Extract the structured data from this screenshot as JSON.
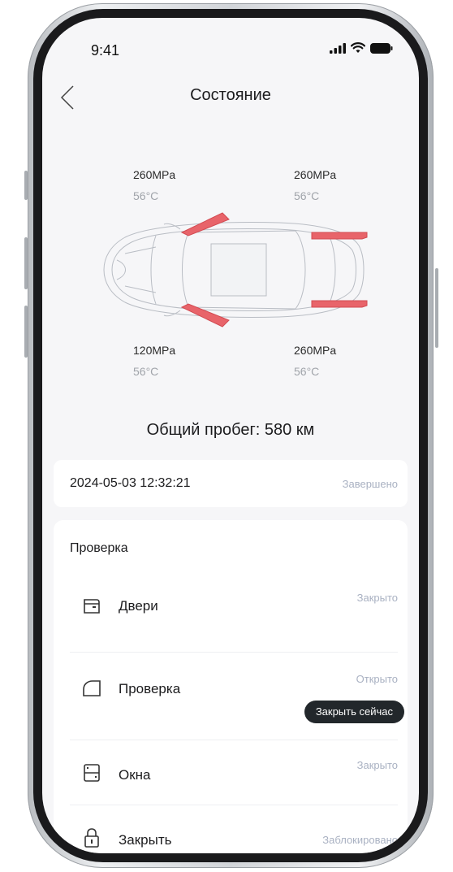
{
  "status_bar": {
    "time": "9:41"
  },
  "header": {
    "title": "Состояние"
  },
  "tyres": {
    "front_left": {
      "pressure": "260MPa",
      "temperature": "56°C"
    },
    "front_right": {
      "pressure": "260MPa",
      "temperature": "56°C"
    },
    "rear_left": {
      "pressure": "120MPa",
      "temperature": "56°C"
    },
    "rear_right": {
      "pressure": "260MPa",
      "temperature": "56°C"
    }
  },
  "mileage": "Общий пробег: 580 км",
  "record": {
    "datetime": "2024-05-03 12:32:21",
    "status": "Завершено"
  },
  "check": {
    "title": "Проверка",
    "items": [
      {
        "label": "Двери",
        "status": "Закрыто",
        "icon": "door-icon"
      },
      {
        "label": "Проверка",
        "status": "Открыто",
        "icon": "trunk-icon",
        "action": "Закрыть сейчас"
      },
      {
        "label": "Окна",
        "status": "Закрыто",
        "icon": "window-icon"
      },
      {
        "label": "Закрыть",
        "status": "Заблокировано",
        "icon": "lock-icon"
      }
    ]
  },
  "colors": {
    "alert": "#e8646a",
    "accent_dark": "#22272b",
    "muted": "#a9b1c2"
  }
}
